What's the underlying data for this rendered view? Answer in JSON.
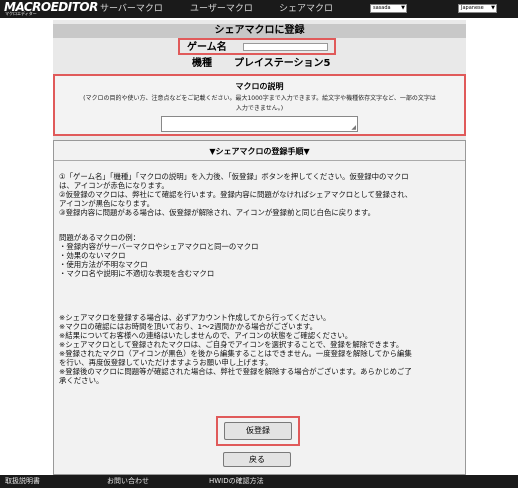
{
  "header": {
    "logo_text": "MACROEDITOR",
    "logo_sub": "マクロエディター",
    "nav": [
      "サーバーマクロ",
      "ユーザーマクロ",
      "シェアマクロ"
    ],
    "user_select": "sasada",
    "language_select": "Japanese"
  },
  "page": {
    "title": "シェアマクロに登録",
    "game_label": "ゲーム名",
    "game_value": "",
    "platform_label": "機種",
    "platform_value": "プレイステーション5"
  },
  "description": {
    "title": "マクロの説明",
    "note_line1": "(マクロの目的や使い方、注意点などをご記載ください。最大1000字まで入力できます。絵文字や機種依存文字など、一部の文字は",
    "note_line2": "入力できません。)",
    "value": ""
  },
  "procedure": {
    "title": "▼シェアマクロの登録手順▼",
    "lines": [
      "①「ゲーム名」「機種」「マクロの説明」を入力後、「仮登録」ボタンを押してください。仮登録中のマクロ",
      "は、アイコンが赤色になります。",
      "②仮登録のマクロは、弊社にて確認を行います。登録内容に問題がなければシェアマクロとして登録され、",
      "アイコンが黒色になります。",
      "③登録内容に問題がある場合は、仮登録が解除され、アイコンが登録前と同じ白色に戻ります。",
      "",
      "問題があるマクロの例：",
      "・登録内容がサーバーマクロやシェアマクロと同一のマクロ",
      "・効果のないマクロ",
      "・使用方法が不明なマクロ",
      "・マクロ名や説明に不適切な表現を含むマクロ",
      "",
      "※シェアマクロを登録する場合は、必ずアカウント作成してから行ってください。",
      "※マクロの確認にはお時間を頂いており、1〜2週間かかる場合がございます。",
      "※結果についてお客様への連絡はいたしませんので、アイコンの状態をご確認ください。",
      "※シェアマクロとして登録されたマクロは、ご自身でアイコンを選択することで、登録を解除できます。",
      "※登録されたマクロ（アイコンが黒色）を後から編集することはできません。一度登録を解除してから編集",
      "を行い、再度仮登録していただけますようお願い申し上げます。",
      "※登録後のマクロに問題等が確認された場合は、弊社で登録を解除する場合がございます。あらかじめご了",
      "承ください。"
    ]
  },
  "buttons": {
    "register": "仮登録",
    "back": "戻る"
  },
  "footer": {
    "links": [
      "取扱説明書",
      "お問い合わせ",
      "HWIDの確認方法"
    ]
  },
  "colors": {
    "header_bg": "#1a1a1a",
    "highlight_border": "#e05a5a",
    "panel_bg": "#e9e9e9"
  }
}
